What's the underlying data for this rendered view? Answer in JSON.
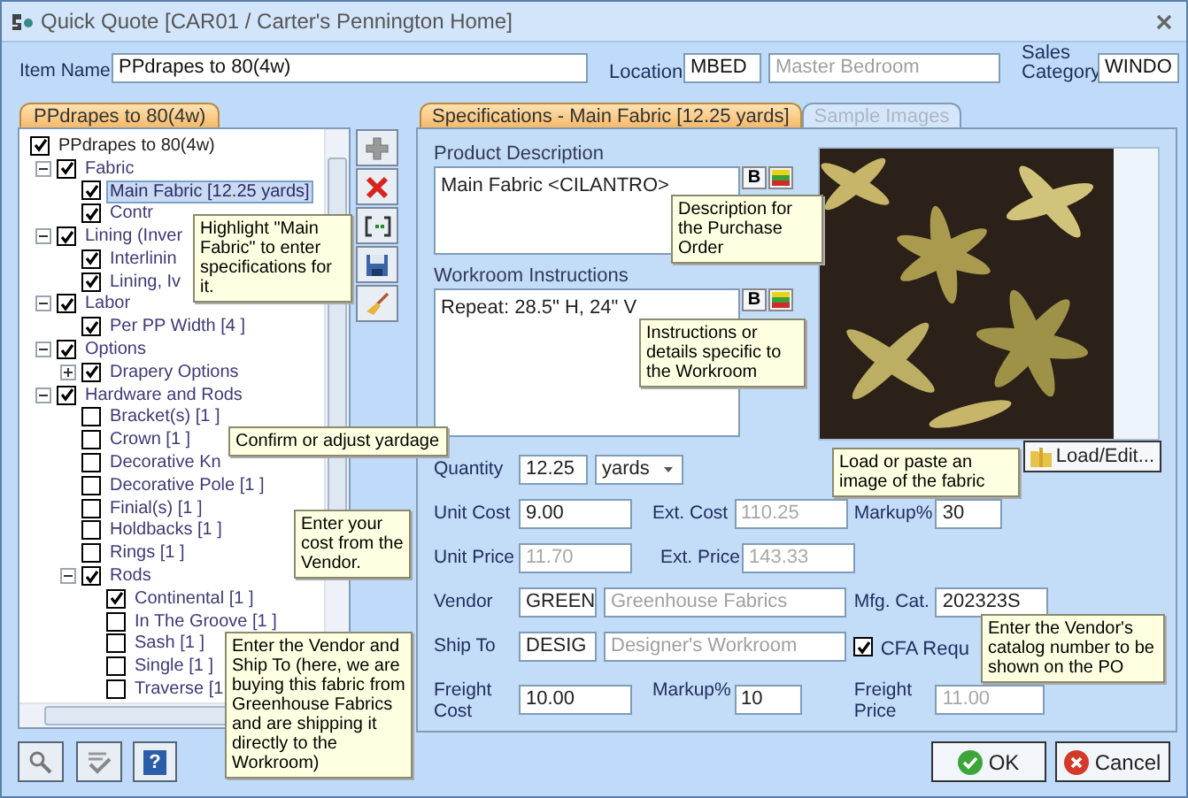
{
  "window": {
    "title": "Quick Quote [CAR01 / Carter's Pennington Home]"
  },
  "header": {
    "item_name": {
      "label": "Item Name",
      "value": "PPdrapes to  80(4w)"
    },
    "location": {
      "label": "Location",
      "code": "MBED",
      "name": "Master Bedroom"
    },
    "sales_category": {
      "label": "Sales Category",
      "value": "WINDO"
    }
  },
  "item_tab": {
    "label": "PPdrapes to  80(4w)"
  },
  "tree": [
    {
      "label": "PPdrapes to  80(4w)",
      "checked": true,
      "selected": false,
      "children": [
        {
          "label": "Fabric",
          "checked": true,
          "selected": false,
          "expanded": true,
          "children": [
            {
              "label": "Main Fabric [12.25 yards]",
              "checked": true,
              "selected": true
            },
            {
              "label": "Contr",
              "checked": true,
              "selected": false
            }
          ]
        },
        {
          "label": "Lining (Inver",
          "checked": true,
          "selected": false,
          "expanded": true,
          "children": [
            {
              "label": "Interlinin",
              "checked": true,
              "selected": false
            },
            {
              "label": "Lining, Iv",
              "checked": true,
              "selected": false
            }
          ]
        },
        {
          "label": "Labor",
          "checked": true,
          "selected": false,
          "expanded": true,
          "children": [
            {
              "label": "Per PP Width [4 ]",
              "checked": true,
              "selected": false
            }
          ]
        },
        {
          "label": "Options",
          "checked": true,
          "selected": false,
          "expanded": true,
          "children": [
            {
              "label": "Drapery Options",
              "checked": true,
              "selected": false,
              "expanded": false
            }
          ]
        },
        {
          "label": "Hardware and Rods",
          "checked": true,
          "selected": false,
          "expanded": true,
          "children": [
            {
              "label": "Bracket(s) [1 ]",
              "checked": false,
              "selected": false
            },
            {
              "label": "Crown [1 ]",
              "checked": false,
              "selected": false
            },
            {
              "label": "Decorative Kn",
              "checked": false,
              "selected": false
            },
            {
              "label": "Decorative Pole [1 ]",
              "checked": false,
              "selected": false
            },
            {
              "label": "Finial(s) [1 ]",
              "checked": false,
              "selected": false
            },
            {
              "label": "Holdbacks [1 ]",
              "checked": false,
              "selected": false
            },
            {
              "label": "Rings [1 ]",
              "checked": false,
              "selected": false
            },
            {
              "label": "Rods",
              "checked": true,
              "selected": false,
              "expanded": true,
              "children": [
                {
                  "label": "Continental [1 ]",
                  "checked": true,
                  "selected": false
                },
                {
                  "label": "In The Groove [1 ]",
                  "checked": false,
                  "selected": false
                },
                {
                  "label": "Sash [1 ]",
                  "checked": false,
                  "selected": false
                },
                {
                  "label": "Single [1 ]",
                  "checked": false,
                  "selected": false
                },
                {
                  "label": "Traverse [1",
                  "checked": false,
                  "selected": false
                }
              ]
            }
          ]
        }
      ]
    }
  ],
  "tabs": [
    {
      "label": "Specifications - Main Fabric [12.25 yards]",
      "selected": true
    },
    {
      "label": "Sample Images",
      "selected": false
    }
  ],
  "product_description": {
    "label": "Product Description",
    "value": "Main Fabric <CILANTRO>",
    "bold_button": "B"
  },
  "workroom_instructions": {
    "label": "Workroom Instructions",
    "value": "Repeat: 28.5\" H, 24\" V",
    "bold_button": "B"
  },
  "form_rows": [
    [
      {
        "kind": "quantity",
        "label": "Quantity",
        "value": "12.25",
        "unit": "yards"
      },
      {
        "kind": "button",
        "label": "Load/Edit..."
      }
    ],
    [
      {
        "kind": "field",
        "label": "Unit Cost",
        "value": "9.00",
        "disabled": false
      },
      {
        "kind": "field",
        "label": "Ext. Cost",
        "value": "110.25",
        "disabled": true
      },
      {
        "kind": "field",
        "label": "Markup%",
        "value": "30",
        "disabled": false
      }
    ],
    [
      {
        "kind": "field",
        "label": "Unit Price",
        "value": "11.70",
        "disabled": true
      },
      {
        "kind": "field",
        "label": "Ext. Price",
        "value": "143.33",
        "disabled": true
      }
    ],
    [
      {
        "kind": "pair",
        "label": "Vendor",
        "code": "GREEN",
        "name": "Greenhouse Fabrics"
      },
      {
        "kind": "field",
        "label": "Mfg. Cat.",
        "value": "202323S",
        "disabled": false
      }
    ],
    [
      {
        "kind": "pair",
        "label": "Ship To",
        "code": "DESIG",
        "name": "Designer's Workroom"
      },
      {
        "kind": "checkbox",
        "label": "CFA Requ",
        "checked": true
      }
    ],
    [
      {
        "kind": "field",
        "label": "Freight Cost",
        "value": "10.00",
        "disabled": false
      },
      {
        "kind": "field",
        "label": "Markup%",
        "value": "10",
        "disabled": false
      },
      {
        "kind": "field",
        "label": "Freight Price",
        "value": "11.00",
        "disabled": true
      }
    ]
  ],
  "help_button": "?",
  "buttons": [
    {
      "kind": "ok",
      "label": "OK"
    },
    {
      "kind": "cancel",
      "label": "Cancel"
    }
  ],
  "tooltips": [
    {
      "text": "Highlight \"Main Fabric\" to enter specifications for it."
    },
    {
      "text": "Confirm or adjust yardage"
    },
    {
      "text": "Enter your cost from the Vendor."
    },
    {
      "text": "Enter the Vendor and Ship To (here, we are buying this fabric from Greenhouse Fabrics and are shipping it directly to the Workroom)"
    },
    {
      "text": "Description for the Purchase Order"
    },
    {
      "text": "Instructions or details specific to the Workroom"
    },
    {
      "text": "Load or paste an image of the fabric"
    },
    {
      "text": "Enter the Vendor's catalog number to be shown on the PO"
    }
  ]
}
